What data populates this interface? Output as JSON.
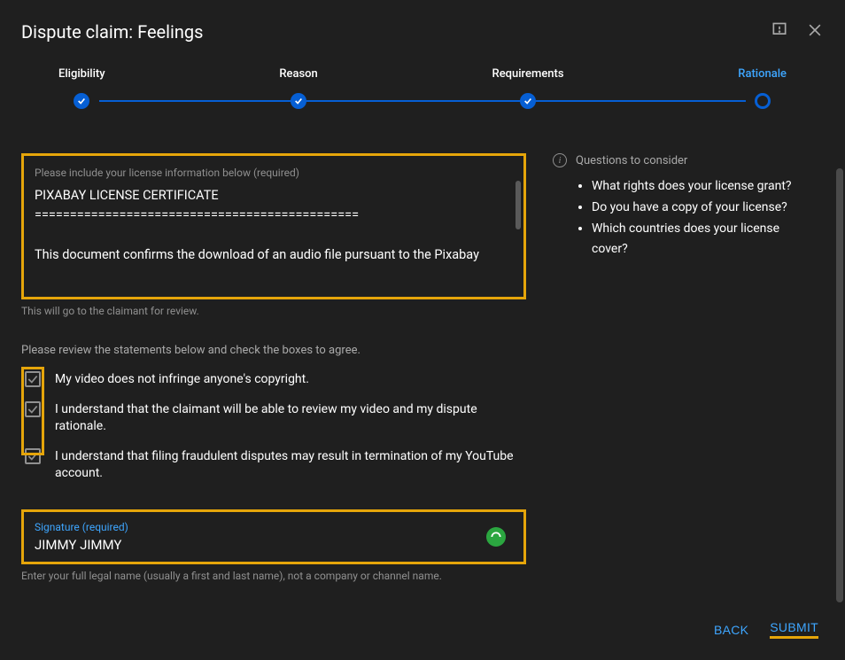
{
  "header": {
    "title": "Dispute claim: Feelings"
  },
  "stepper": {
    "steps": [
      {
        "label": "Eligibility",
        "done": true
      },
      {
        "label": "Reason",
        "done": true
      },
      {
        "label": "Requirements",
        "done": true
      },
      {
        "label": "Rationale",
        "current": true
      }
    ]
  },
  "license": {
    "placeholder": "Please include your license information below (required)",
    "line1": "PIXABAY LICENSE CERTIFICATE",
    "line2": "==============================================",
    "line3": "This document confirms the download of an audio file pursuant to the Pixabay",
    "helper": "This will go to the claimant for review."
  },
  "review": {
    "intro": "Please review the statements below and check the boxes to agree.",
    "items": [
      "My video does not infringe anyone's copyright.",
      "I understand that the claimant will be able to review my video and my dispute rationale.",
      "I understand that filing fraudulent disputes may result in termination of my YouTube account."
    ]
  },
  "signature": {
    "label": "Signature (required)",
    "value": "JIMMY JIMMY",
    "helper": "Enter your full legal name (usually a first and last name), not a company or channel name."
  },
  "sidebar": {
    "title": "Questions to consider",
    "items": [
      "What rights does your license grant?",
      "Do you have a copy of your license?",
      "Which countries does your license cover?"
    ]
  },
  "footer": {
    "back": "BACK",
    "submit": "SUBMIT"
  }
}
